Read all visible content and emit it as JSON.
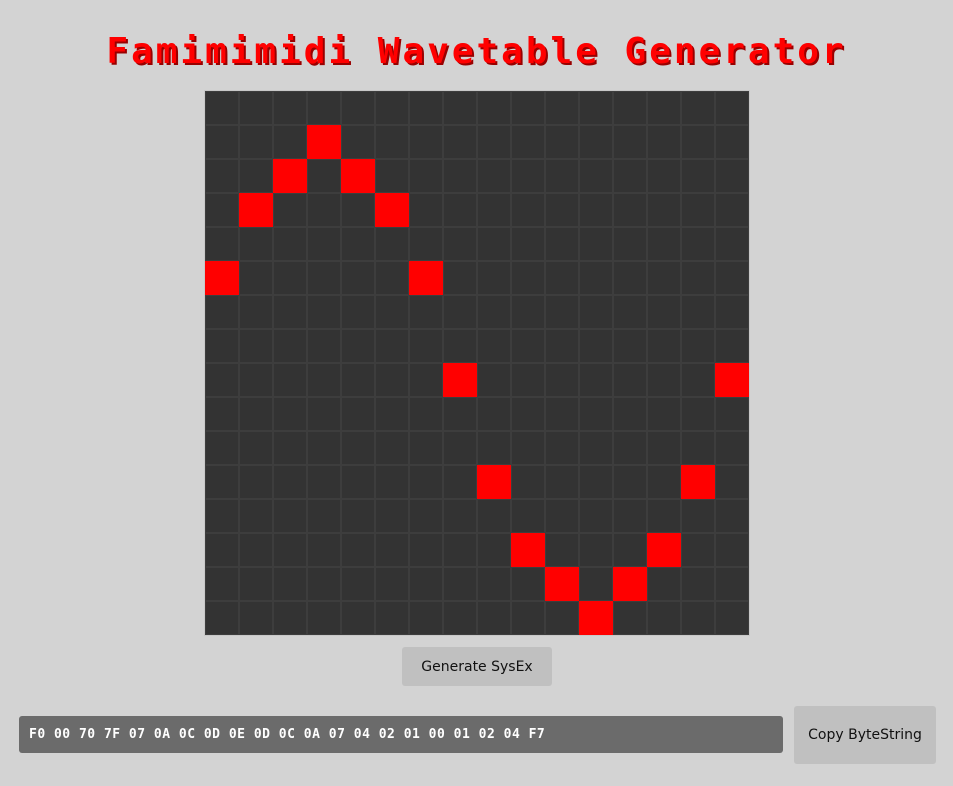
{
  "title": "Famimimidi Wavetable Generator",
  "wavetable": {
    "columns": 16,
    "rows": 16,
    "values": [
      10,
      12,
      13,
      14,
      13,
      12,
      10,
      7,
      4,
      2,
      1,
      0,
      1,
      2,
      4,
      7
    ]
  },
  "generate_button_label": "Generate SysEx",
  "sysex_output": "F0 00 70 7F 07 0A 0C 0D 0E 0D 0C 0A 07 04 02 01 00 01 02 04 F7",
  "copy_button_label": "Copy ByteString",
  "colors": {
    "background": "#d3d3d3",
    "title": "#ff0000",
    "cell_on": "#ff0000",
    "cell_off": "#333333"
  }
}
